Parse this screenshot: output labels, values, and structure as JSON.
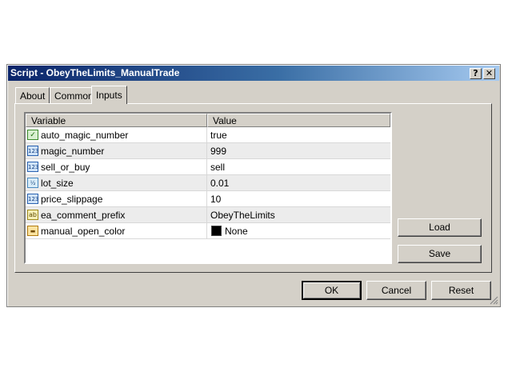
{
  "window": {
    "title": "Script - ObeyTheLimits_ManualTrade",
    "help_label": "?",
    "close_label": "✕"
  },
  "tabs": [
    {
      "label": "About"
    },
    {
      "label": "Common"
    },
    {
      "label": "Inputs"
    }
  ],
  "active_tab": "Inputs",
  "grid": {
    "columns": [
      "Variable",
      "Value"
    ],
    "rows": [
      {
        "icon": "bool-icon",
        "icon_text": "✓",
        "name": "auto_magic_number",
        "value": "true"
      },
      {
        "icon": "int-icon",
        "icon_text": "123",
        "name": "magic_number",
        "value": "999"
      },
      {
        "icon": "int-icon",
        "icon_text": "123",
        "name": "sell_or_buy",
        "value": "sell"
      },
      {
        "icon": "double-icon",
        "icon_text": "½",
        "name": "lot_size",
        "value": "0.01"
      },
      {
        "icon": "int-icon",
        "icon_text": "123",
        "name": "price_slippage",
        "value": "10"
      },
      {
        "icon": "string-icon",
        "icon_text": "ab",
        "name": "ea_comment_prefix",
        "value": "ObeyTheLimits"
      },
      {
        "icon": "color-icon",
        "icon_text": "",
        "name": "manual_open_color",
        "value": "None",
        "swatch_color": "#000000"
      }
    ]
  },
  "side_buttons": {
    "load": "Load",
    "save": "Save"
  },
  "footer_buttons": {
    "ok": "OK",
    "cancel": "Cancel",
    "reset": "Reset"
  }
}
